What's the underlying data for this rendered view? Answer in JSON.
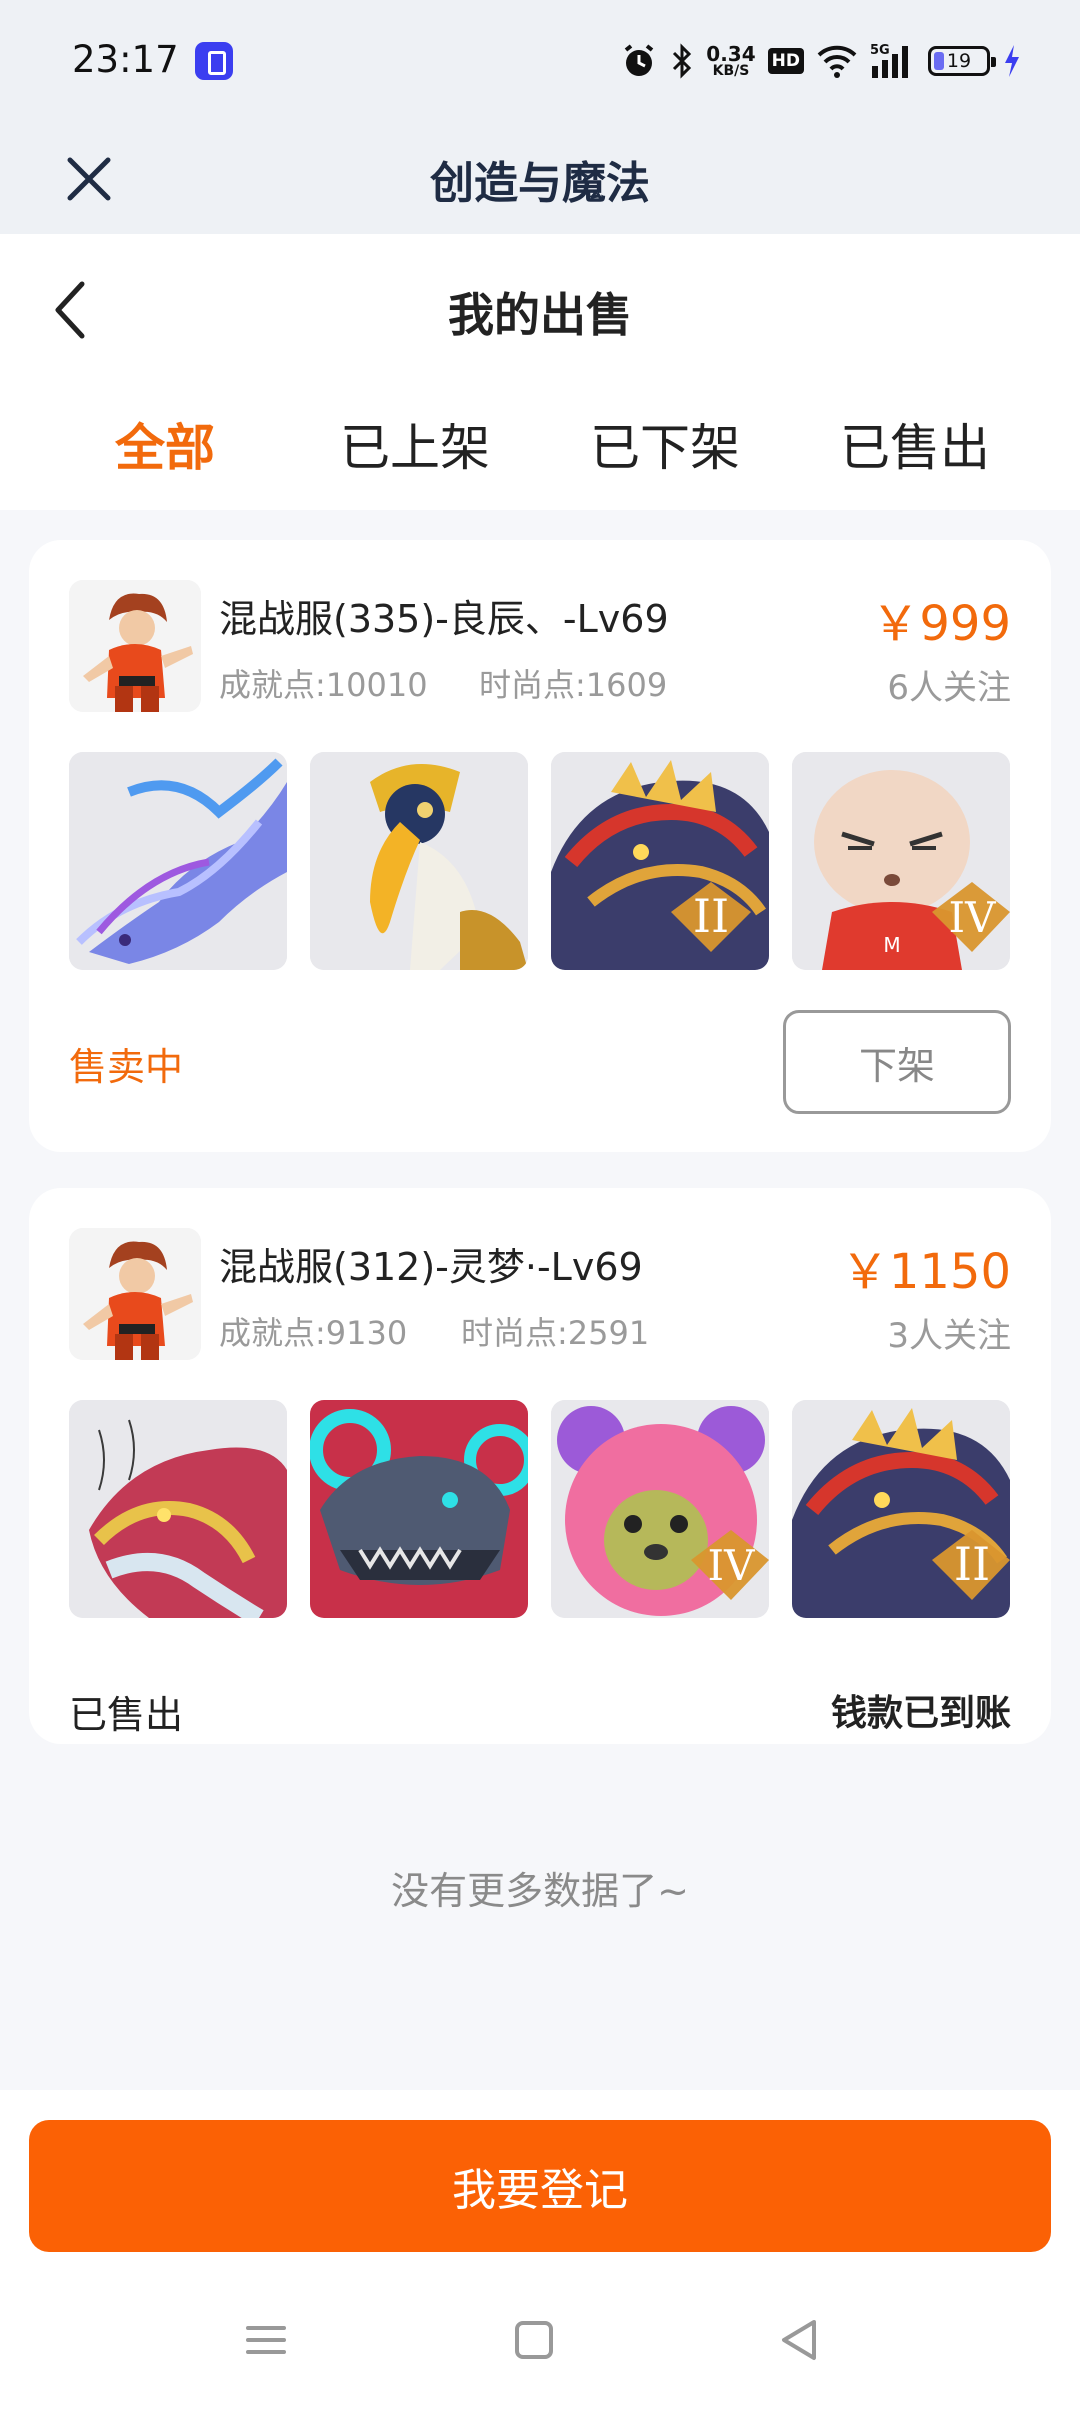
{
  "status_bar": {
    "time": "23:17",
    "net_speed_value": "0.34",
    "net_speed_unit": "KB/S",
    "hd_label": "HD",
    "network_label": "5G",
    "battery_level": "19"
  },
  "app_header": {
    "title": "创造与魔法"
  },
  "page_header": {
    "title": "我的出售"
  },
  "tabs": [
    {
      "label": "全部",
      "active": true
    },
    {
      "label": "已上架",
      "active": false
    },
    {
      "label": "已下架",
      "active": false
    },
    {
      "label": "已售出",
      "active": false
    }
  ],
  "listings": [
    {
      "title": "混战服(335)-良辰、-Lv69",
      "achievement": "成就点:10010",
      "fashion": "时尚点:1609",
      "price": "￥999",
      "followers": "6人关注",
      "status": "售卖中",
      "status_color": "#f26a0c",
      "action_label": "下架",
      "thumb_badges": [
        "",
        "",
        "II",
        "IV"
      ]
    },
    {
      "title": "混战服(312)-灵梦·-Lv69",
      "achievement": "成就点:9130",
      "fashion": "时尚点:2591",
      "price": "￥1150",
      "followers": "3人关注",
      "status": "已售出",
      "status_color": "#222222",
      "payout_label": "钱款已到账",
      "thumb_badges": [
        "",
        "",
        "IV",
        "II"
      ]
    }
  ],
  "footer": {
    "no_more": "没有更多数据了~",
    "register_label": "我要登记"
  },
  "colors": {
    "accent": "#f26a0c",
    "button": "#fb6105",
    "background": "#f6f7fa"
  }
}
